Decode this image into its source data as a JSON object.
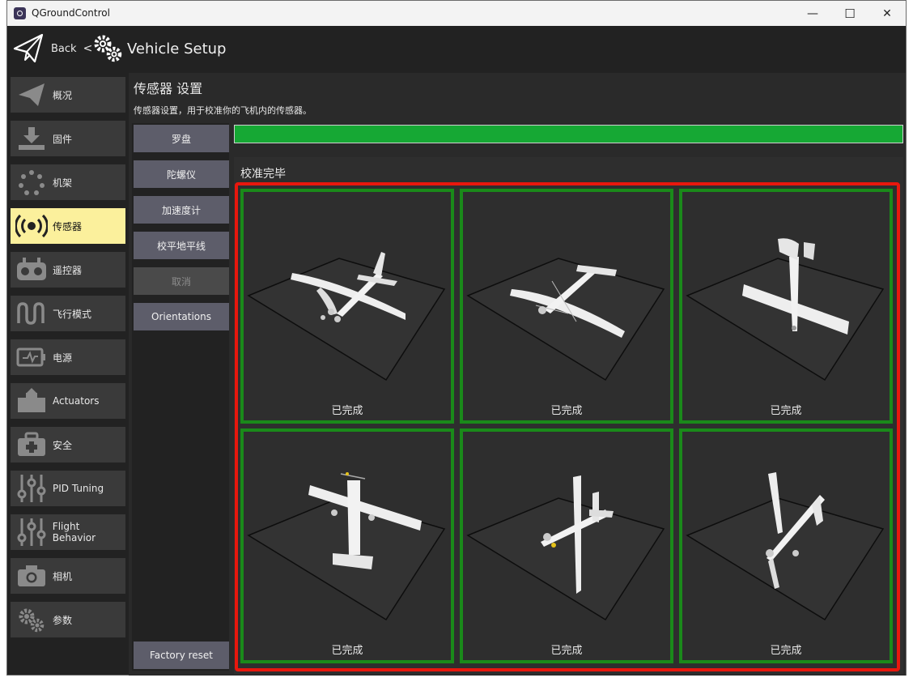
{
  "window": {
    "title": "QGroundControl",
    "minimize": "—",
    "maximize": "☐",
    "close": "✕"
  },
  "header": {
    "back_label": "Back",
    "separator": "<",
    "title": "Vehicle Setup"
  },
  "sidebar": {
    "items": [
      {
        "label": "概况",
        "icon": "plane-icon"
      },
      {
        "label": "固件",
        "icon": "download-icon"
      },
      {
        "label": "机架",
        "icon": "frame-dots-icon"
      },
      {
        "label": "传感器",
        "icon": "sensor-icon"
      },
      {
        "label": "遥控器",
        "icon": "radio-icon"
      },
      {
        "label": "飞行模式",
        "icon": "wave-icon"
      },
      {
        "label": "电源",
        "icon": "battery-icon"
      },
      {
        "label": "Actuators",
        "icon": "actuator-icon"
      },
      {
        "label": "安全",
        "icon": "medkit-icon"
      },
      {
        "label": "PID Tuning",
        "icon": "sliders-icon"
      },
      {
        "label": "Flight Behavior",
        "icon": "sliders-icon"
      },
      {
        "label": "相机",
        "icon": "camera-icon"
      },
      {
        "label": "参数",
        "icon": "gears-icon"
      }
    ],
    "active_index": 3
  },
  "main": {
    "title": "传感器 设置",
    "description": "传感器设置，用于校准你的飞机内的传感器。",
    "subnav": {
      "compass": "罗盘",
      "gyro": "陀螺仪",
      "accel": "加速度计",
      "level": "校平地平线",
      "cancel": "取消",
      "orientations": "Orientations",
      "factory_reset": "Factory reset"
    },
    "progress": 1.0,
    "calibration": {
      "title": "校准完毕",
      "cells": [
        {
          "status": "已完成",
          "orientation": "level"
        },
        {
          "status": "已完成",
          "orientation": "upside-down"
        },
        {
          "status": "已完成",
          "orientation": "nose-down"
        },
        {
          "status": "已完成",
          "orientation": "nose-up"
        },
        {
          "status": "已完成",
          "orientation": "left-side"
        },
        {
          "status": "已完成",
          "orientation": "right-side"
        }
      ]
    }
  },
  "colors": {
    "active": "#fbf09c",
    "progress": "#16a834",
    "done_border": "#1a8a1a",
    "highlight": "#e8170d"
  }
}
